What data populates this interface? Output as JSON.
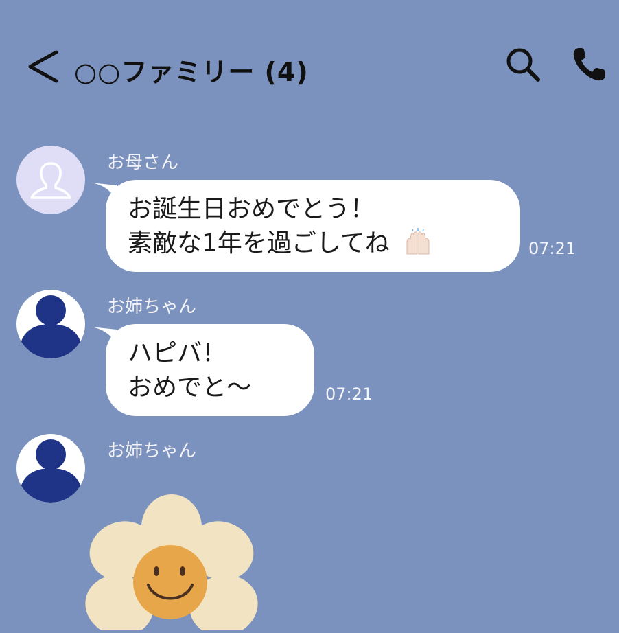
{
  "header": {
    "title": "○○ファミリー (4)",
    "back_icon": "chevron-left-icon",
    "search_icon": "search-icon",
    "call_icon": "phone-icon"
  },
  "messages": [
    {
      "sender": "お母さん",
      "avatar": "default-user-icon",
      "lines": [
        "お誕生日おめでとう！",
        "素敵な1年を過ごしてね"
      ],
      "emoji": "raised-hands-icon",
      "time": "07:21"
    },
    {
      "sender": "お姉ちゃん",
      "avatar": "user-silhouette-icon",
      "lines": [
        "ハピバ！",
        "おめでと〜"
      ],
      "time": "07:21"
    },
    {
      "sender": "お姉ちゃん",
      "avatar": "user-silhouette-icon",
      "sticker": "smiling-flower-sticker"
    }
  ],
  "colors": {
    "background": "#7a92bd",
    "bubble": "#ffffff",
    "sister_avatar": "#1f3487",
    "mom_avatar": "#e0def6",
    "flower_petal": "#f2e3c2",
    "flower_center": "#e8a64a"
  }
}
